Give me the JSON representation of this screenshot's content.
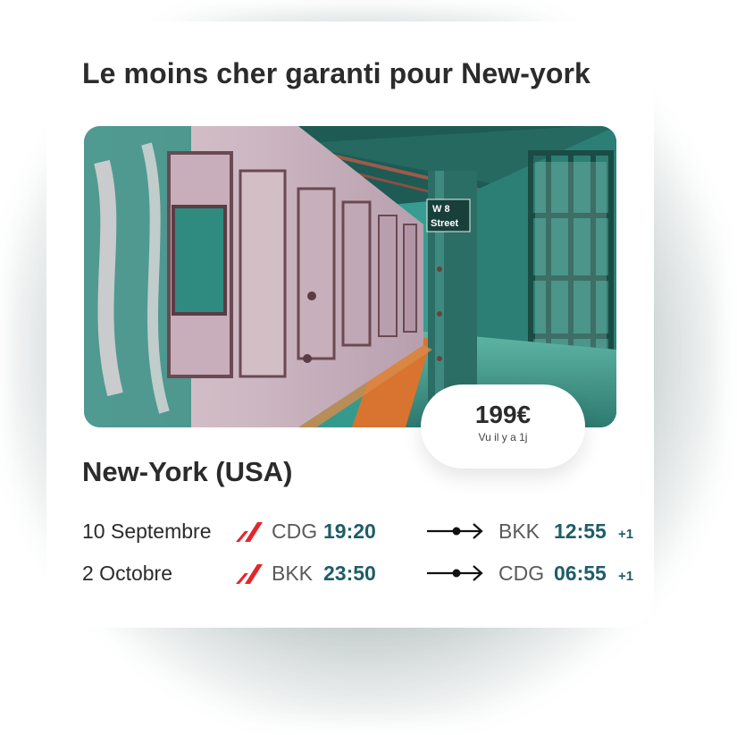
{
  "card": {
    "title": "Le moins cher garanti pour New-york",
    "destination": "New-York (USA)",
    "price": "199€",
    "price_note": "Vu il y a 1j",
    "photo_sign_line1": "W 8",
    "photo_sign_line2": "Street"
  },
  "flights": [
    {
      "date": "10 Septembre",
      "from_code": "CDG",
      "from_time": "19:20",
      "to_code": "BKK",
      "to_time": "12:55",
      "day_offset": "+1"
    },
    {
      "date": "2 Octobre",
      "from_code": "BKK",
      "from_time": "23:50",
      "to_code": "CDG",
      "to_time": "06:55",
      "day_offset": "+1"
    }
  ],
  "colors": {
    "accent_time": "#1f5c68",
    "airline_mark": "#e3262b",
    "text": "#2b2b2b"
  },
  "icons": {
    "airline": "airline-logo-icon",
    "arrow": "flight-arrow-icon"
  }
}
